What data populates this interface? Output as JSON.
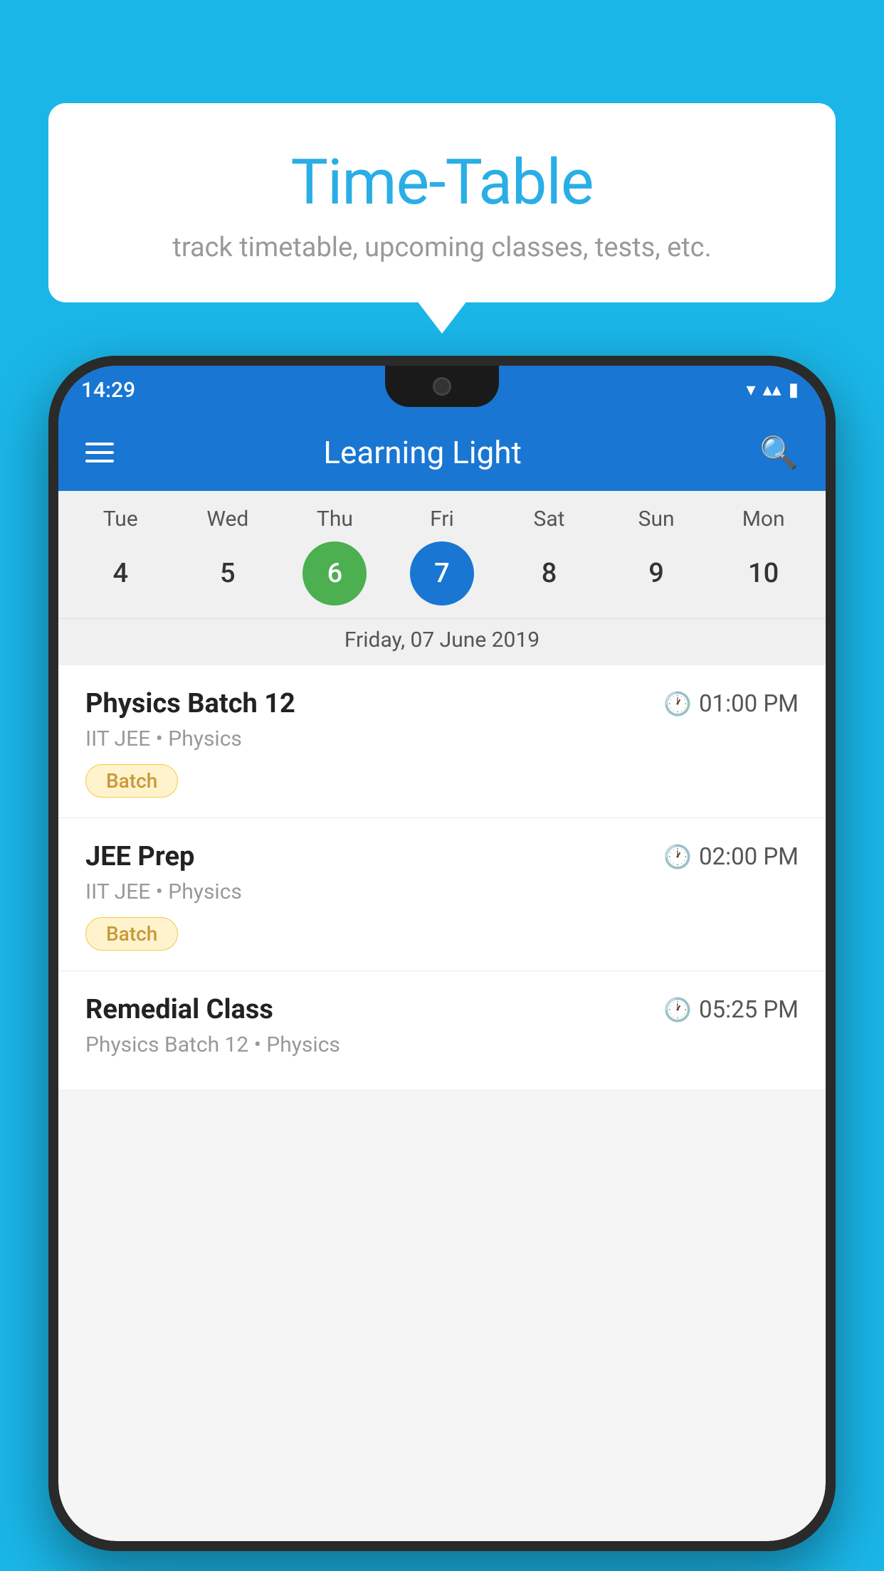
{
  "background_color": "#1ab6e8",
  "speech_bubble": {
    "title": "Time-Table",
    "subtitle": "track timetable, upcoming classes, tests, etc."
  },
  "phone": {
    "status_bar": {
      "time": "14:29"
    },
    "app_bar": {
      "title": "Learning Light"
    },
    "calendar": {
      "days": [
        {
          "label": "Tue",
          "num": "4"
        },
        {
          "label": "Wed",
          "num": "5"
        },
        {
          "label": "Thu",
          "num": "6",
          "state": "today"
        },
        {
          "label": "Fri",
          "num": "7",
          "state": "selected"
        },
        {
          "label": "Sat",
          "num": "8"
        },
        {
          "label": "Sun",
          "num": "9"
        },
        {
          "label": "Mon",
          "num": "10"
        }
      ],
      "selected_date_label": "Friday, 07 June 2019"
    },
    "schedule": [
      {
        "title": "Physics Batch 12",
        "time": "01:00 PM",
        "subtitle": "IIT JEE • Physics",
        "badge": "Batch"
      },
      {
        "title": "JEE Prep",
        "time": "02:00 PM",
        "subtitle": "IIT JEE • Physics",
        "badge": "Batch"
      },
      {
        "title": "Remedial Class",
        "time": "05:25 PM",
        "subtitle": "Physics Batch 12 • Physics",
        "badge": null
      }
    ]
  }
}
